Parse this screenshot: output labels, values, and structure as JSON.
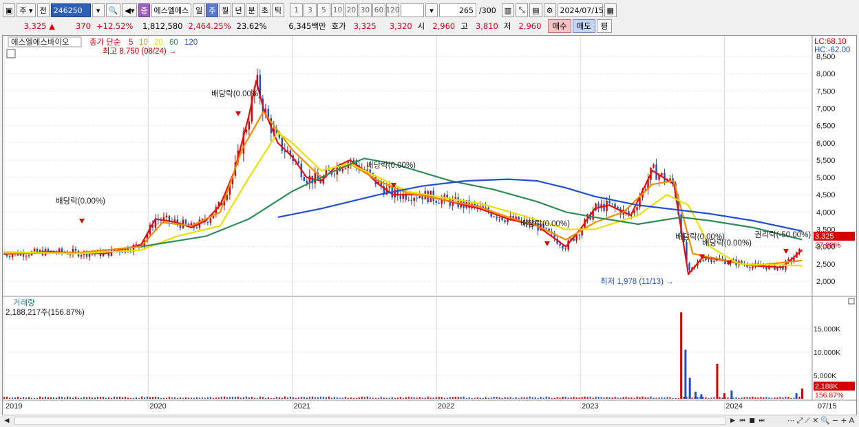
{
  "toolbar": {
    "market_type": "주",
    "prev_label": "전",
    "code": "246250",
    "stock_name": "에스엘에스",
    "stock_badge": "종",
    "periods": [
      "일",
      "주",
      "월",
      "년",
      "분",
      "초",
      "틱"
    ],
    "active_period": "주",
    "intervals": [
      "1",
      "3",
      "5",
      "10",
      "20",
      "30",
      "60",
      "120"
    ],
    "count": "265",
    "count_total": "/300",
    "date": "2024/07/15"
  },
  "quote": {
    "price": "3,325",
    "change": "370",
    "change_pct": "+12.52%",
    "volume": "1,812,580",
    "volume_ratio": "2,464.25%",
    "turnover": "23.62%",
    "amount": "6,345백만",
    "bid_label": "호가",
    "ask_price": "3,325",
    "bid_price": "3,320",
    "open_label": "시",
    "open": "2,960",
    "high_label": "고",
    "high": "3,810",
    "low_label": "저",
    "low": "2,960",
    "buy_label": "매수",
    "sell_label": "매도",
    "eval_label": "평"
  },
  "chart": {
    "stock_title": "에스엘에스바이오",
    "ma_label": "종가 단순",
    "ma_periods": [
      {
        "label": "5",
        "color": "#e01010"
      },
      {
        "label": "10",
        "color": "#f08c00"
      },
      {
        "label": "20",
        "color": "#e8e000"
      },
      {
        "label": "60",
        "color": "#2e8b57"
      },
      {
        "label": "120",
        "color": "#2050d0"
      }
    ],
    "high_annotation": "최고 8,750 (08/24)",
    "low_annotation": "최저 1,978 (11/13)",
    "ex_div_label": "배당락(0.00%)",
    "ex_rights_label": "권리락(-50.00%)",
    "lc_label": "LC:68.10",
    "hc_label": "HC:-62.00",
    "price_tag": "3,325",
    "pct_tag": "27.88%",
    "volume_title": "거래량",
    "volume_value": "2,188,217주(156.87%)",
    "vol_tag": "2,188K",
    "vol_pct_tag": "156.87%",
    "x_labels": [
      "2019",
      "2020",
      "2021",
      "2022",
      "2023",
      "2024",
      "07/15"
    ],
    "price_axis": [
      "8,500",
      "8,000",
      "7,500",
      "7,000",
      "6,500",
      "6,000",
      "5,500",
      "5,000",
      "4,500",
      "4,000",
      "3,500",
      "3,000",
      "2,500",
      "2,000"
    ],
    "volume_axis": [
      "15,000K",
      "10,000K",
      "5,000K"
    ]
  },
  "chart_data": {
    "type": "candlestick",
    "title": "에스엘에스바이오",
    "xlabel": "",
    "ylabel": "",
    "x_ticks": [
      "2019",
      "2020",
      "2021",
      "2022",
      "2023",
      "2024",
      "07/15"
    ],
    "ylim": [
      1800,
      8750
    ],
    "grid": true,
    "ma_series": [
      {
        "name": "5",
        "color": "#e01010",
        "points": [
          [
            2019.0,
            2780
          ],
          [
            2019.3,
            2850
          ],
          [
            2019.7,
            2800
          ],
          [
            2019.95,
            3050
          ],
          [
            2020.05,
            3800
          ],
          [
            2020.2,
            3700
          ],
          [
            2020.3,
            3550
          ],
          [
            2020.4,
            3750
          ],
          [
            2020.5,
            4200
          ],
          [
            2020.6,
            5200
          ],
          [
            2020.7,
            6800
          ],
          [
            2020.75,
            7800
          ],
          [
            2020.8,
            7000
          ],
          [
            2020.9,
            6000
          ],
          [
            2021.0,
            5600
          ],
          [
            2021.1,
            5000
          ],
          [
            2021.2,
            4900
          ],
          [
            2021.3,
            5300
          ],
          [
            2021.4,
            5500
          ],
          [
            2021.5,
            5200
          ],
          [
            2021.6,
            4800
          ],
          [
            2021.7,
            4500
          ],
          [
            2021.9,
            4500
          ],
          [
            2022.1,
            4300
          ],
          [
            2022.3,
            4100
          ],
          [
            2022.5,
            3800
          ],
          [
            2022.7,
            3600
          ],
          [
            2022.9,
            3000
          ],
          [
            2023.0,
            3500
          ],
          [
            2023.1,
            4100
          ],
          [
            2023.2,
            4200
          ],
          [
            2023.35,
            3900
          ],
          [
            2023.5,
            5200
          ],
          [
            2023.65,
            4800
          ],
          [
            2023.75,
            2200
          ],
          [
            2023.85,
            2700
          ],
          [
            2024.0,
            2600
          ],
          [
            2024.2,
            2450
          ],
          [
            2024.4,
            2400
          ],
          [
            2024.54,
            2900
          ]
        ]
      },
      {
        "name": "10",
        "color": "#f08c00",
        "points": [
          [
            2019.0,
            2800
          ],
          [
            2019.5,
            2820
          ],
          [
            2019.95,
            3000
          ],
          [
            2020.1,
            3700
          ],
          [
            2020.3,
            3600
          ],
          [
            2020.5,
            4000
          ],
          [
            2020.65,
            5800
          ],
          [
            2020.8,
            6900
          ],
          [
            2021.0,
            5800
          ],
          [
            2021.2,
            5000
          ],
          [
            2021.4,
            5400
          ],
          [
            2021.6,
            4900
          ],
          [
            2021.8,
            4550
          ],
          [
            2022.0,
            4400
          ],
          [
            2022.3,
            4150
          ],
          [
            2022.5,
            3850
          ],
          [
            2022.7,
            3600
          ],
          [
            2022.9,
            3200
          ],
          [
            2023.1,
            3700
          ],
          [
            2023.3,
            4000
          ],
          [
            2023.5,
            4800
          ],
          [
            2023.65,
            4900
          ],
          [
            2023.78,
            2800
          ],
          [
            2023.95,
            2650
          ],
          [
            2024.2,
            2450
          ],
          [
            2024.54,
            2600
          ]
        ]
      },
      {
        "name": "20",
        "color": "#e8e000",
        "points": [
          [
            2019.0,
            2850
          ],
          [
            2019.5,
            2800
          ],
          [
            2019.95,
            2900
          ],
          [
            2020.2,
            3300
          ],
          [
            2020.5,
            3600
          ],
          [
            2020.7,
            5000
          ],
          [
            2020.9,
            6300
          ],
          [
            2021.0,
            6000
          ],
          [
            2021.2,
            5200
          ],
          [
            2021.4,
            5400
          ],
          [
            2021.6,
            5000
          ],
          [
            2021.8,
            4600
          ],
          [
            2022.0,
            4450
          ],
          [
            2022.3,
            4250
          ],
          [
            2022.6,
            3900
          ],
          [
            2022.9,
            3500
          ],
          [
            2023.1,
            3500
          ],
          [
            2023.4,
            3900
          ],
          [
            2023.6,
            4500
          ],
          [
            2023.75,
            4200
          ],
          [
            2023.9,
            3000
          ],
          [
            2024.1,
            2500
          ],
          [
            2024.54,
            2450
          ]
        ]
      },
      {
        "name": "60",
        "color": "#2e8b57",
        "points": [
          [
            2019.95,
            3000
          ],
          [
            2020.4,
            3300
          ],
          [
            2020.7,
            3800
          ],
          [
            2021.0,
            4600
          ],
          [
            2021.3,
            5200
          ],
          [
            2021.5,
            5550
          ],
          [
            2021.7,
            5400
          ],
          [
            2021.9,
            5150
          ],
          [
            2022.1,
            4900
          ],
          [
            2022.4,
            4650
          ],
          [
            2022.7,
            4300
          ],
          [
            2022.9,
            4000
          ],
          [
            2023.1,
            3850
          ],
          [
            2023.4,
            3650
          ],
          [
            2023.7,
            3850
          ],
          [
            2023.9,
            3750
          ],
          [
            2024.2,
            3550
          ],
          [
            2024.54,
            3200
          ]
        ]
      },
      {
        "name": "120",
        "color": "#2050d0",
        "points": [
          [
            2020.9,
            3850
          ],
          [
            2021.2,
            4100
          ],
          [
            2021.6,
            4500
          ],
          [
            2021.9,
            4750
          ],
          [
            2022.2,
            4900
          ],
          [
            2022.5,
            4950
          ],
          [
            2022.7,
            4900
          ],
          [
            2022.9,
            4700
          ],
          [
            2023.1,
            4450
          ],
          [
            2023.4,
            4200
          ],
          [
            2023.7,
            4050
          ],
          [
            2023.9,
            3950
          ],
          [
            2024.2,
            3750
          ],
          [
            2024.54,
            3450
          ]
        ]
      }
    ],
    "volume_bars": [
      [
        2023.7,
        18500
      ],
      [
        2023.73,
        10500
      ],
      [
        2023.76,
        4500
      ],
      [
        2023.8,
        1500
      ],
      [
        2023.84,
        1000
      ],
      [
        2023.95,
        7500
      ],
      [
        2024.0,
        1200
      ],
      [
        2024.05,
        1800
      ],
      [
        2024.5,
        1200
      ],
      [
        2024.54,
        2188
      ]
    ]
  }
}
